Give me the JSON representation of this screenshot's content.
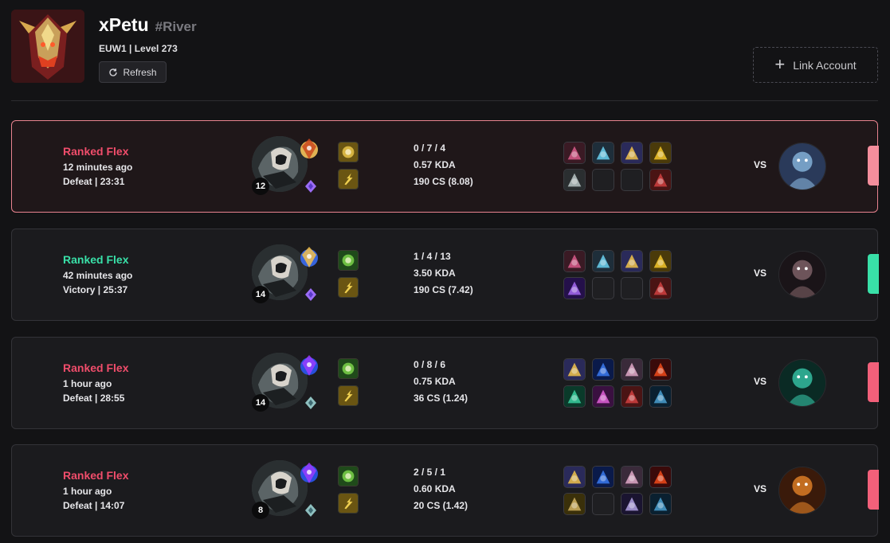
{
  "profile": {
    "game_name": "xPetu",
    "tag_line": "#River",
    "region": "EUW1",
    "level_text": "Level 273",
    "refresh_label": "Refresh",
    "link_account_label": "Link Account"
  },
  "colors": {
    "defeat": "#f04d6b",
    "victory": "#39e0a8",
    "defeat_bar": "#f2607a",
    "defeat_bar_first": "#f48e9c",
    "victory_bar": "#39e0a8"
  },
  "matches": [
    {
      "queue": "Ranked Flex",
      "time_ago": "12 minutes ago",
      "result_line": "Defeat | 23:31",
      "result": "defeat",
      "champion_level": "12",
      "kda": "0 / 7 / 4",
      "kda_ratio": "0.57 KDA",
      "cs": "190 CS (8.08)",
      "vs_label": "VS",
      "primary_rune_icon": "electrocute-rune-icon",
      "secondary_rune_icon": "sorcery-rune-icon",
      "spells": [
        "teleport-icon",
        "flash-icon"
      ],
      "items": [
        "dagger-item-icon",
        "zap-item-icon",
        "orb-item-icon",
        "gold-item-icon",
        "pickaxe-item-icon",
        "empty",
        "empty",
        "boots-item-icon"
      ],
      "opponent_icon": "opponent-champion-blue-icon"
    },
    {
      "queue": "Ranked Flex",
      "time_ago": "42 minutes ago",
      "result_line": "Victory | 25:37",
      "result": "victory",
      "champion_level": "14",
      "kda": "1 / 4 / 13",
      "kda_ratio": "3.50 KDA",
      "cs": "190 CS (7.42)",
      "vs_label": "VS",
      "primary_rune_icon": "arcane-comet-rune-icon",
      "secondary_rune_icon": "sorcery-rune-icon",
      "spells": [
        "ghost-icon",
        "flash-icon"
      ],
      "items": [
        "dagger-item-icon",
        "zap-item-icon",
        "orb-item-icon",
        "gold-item-icon",
        "amethyst-item-icon",
        "empty",
        "empty",
        "boots-item-icon"
      ],
      "opponent_icon": "opponent-champion-dark-icon"
    },
    {
      "queue": "Ranked Flex",
      "time_ago": "1 hour ago",
      "result_line": "Defeat | 28:55",
      "result": "defeat",
      "champion_level": "14",
      "kda": "0 / 8 / 6",
      "kda_ratio": "0.75 KDA",
      "cs": "36 CS (1.24)",
      "vs_label": "VS",
      "primary_rune_icon": "guardian-rune-icon",
      "secondary_rune_icon": "resolve-rune-icon",
      "spells": [
        "ghost-icon",
        "flash-icon"
      ],
      "items": [
        "orb-item-icon",
        "teardrop-item-icon",
        "pig-item-icon",
        "volcano-item-icon",
        "jade-item-icon",
        "blossom-item-icon",
        "boots-item-icon",
        "ward-item-icon"
      ],
      "opponent_icon": "opponent-champion-green-icon"
    },
    {
      "queue": "Ranked Flex",
      "time_ago": "1 hour ago",
      "result_line": "Defeat | 14:07",
      "result": "defeat",
      "champion_level": "8",
      "kda": "2 / 5 / 1",
      "kda_ratio": "0.60 KDA",
      "cs": "20 CS (1.42)",
      "vs_label": "VS",
      "primary_rune_icon": "guardian-rune-icon",
      "secondary_rune_icon": "resolve-rune-icon",
      "spells": [
        "ghost-icon",
        "flash-icon"
      ],
      "items": [
        "orb-item-icon",
        "teardrop-item-icon",
        "pig-item-icon",
        "volcano-item-icon",
        "armor-item-icon",
        "empty",
        "boots-blue-item-icon",
        "ward-item-icon"
      ],
      "opponent_icon": "opponent-champion-orange-icon"
    }
  ]
}
